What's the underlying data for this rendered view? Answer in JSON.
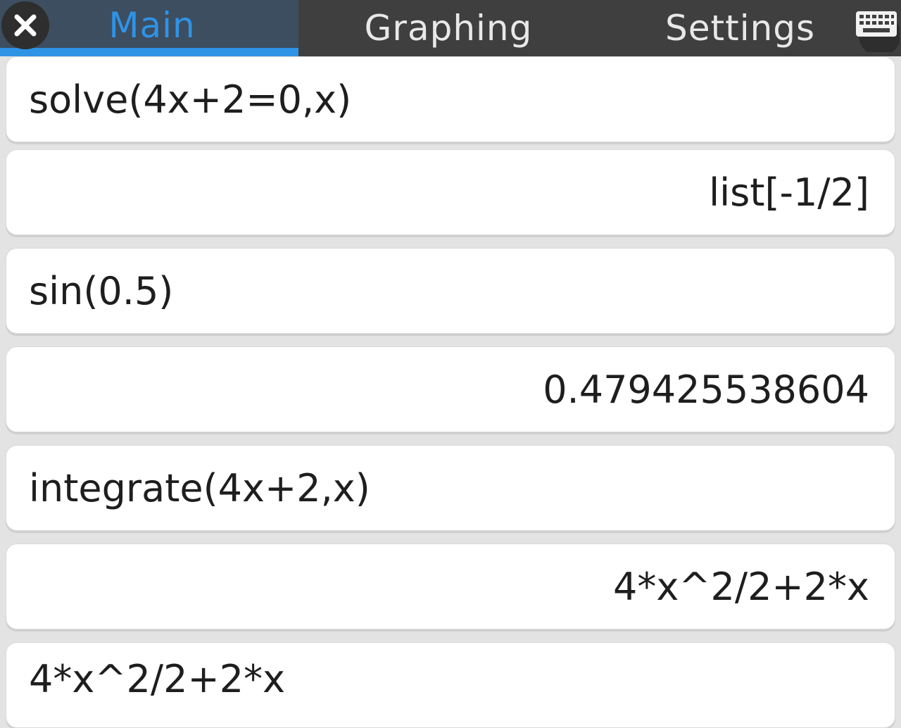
{
  "tabs": {
    "main": "Main",
    "graphing": "Graphing",
    "settings": "Settings"
  },
  "icons": {
    "close": "close-icon",
    "keyboard": "keyboard-icon"
  },
  "colors": {
    "accent": "#2f93e6",
    "topbar": "#3f3f3f",
    "active_tab": "#3c4e60"
  },
  "history": [
    {
      "kind": "input",
      "text": "solve(4x+2=0,x)"
    },
    {
      "kind": "output",
      "text": "list[-1/2]"
    },
    {
      "kind": "input",
      "text": "sin(0.5)"
    },
    {
      "kind": "output",
      "text": "0.479425538604"
    },
    {
      "kind": "input",
      "text": "integrate(4x+2,x)"
    },
    {
      "kind": "output",
      "text": "4*x^2/2+2*x"
    },
    {
      "kind": "input",
      "text": "4*x^2/2+2*x"
    }
  ]
}
